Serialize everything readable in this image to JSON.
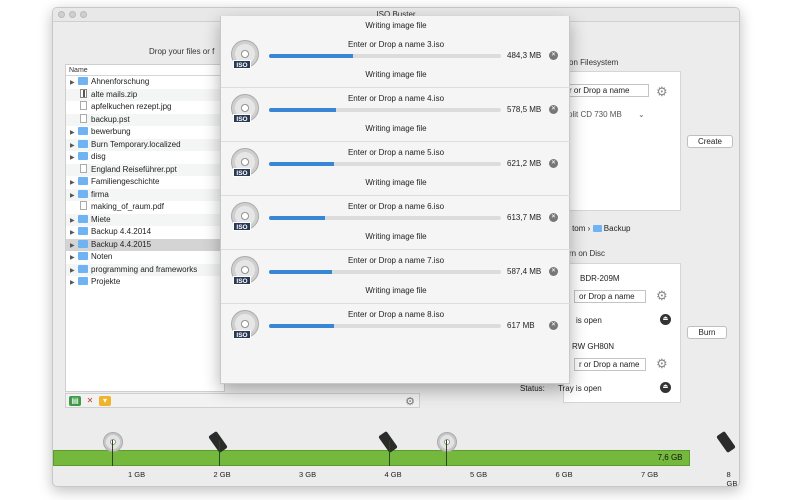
{
  "window": {
    "title": "ISO Buster"
  },
  "left": {
    "drop_hint": "Drop your files or f",
    "column_header": "Name",
    "files": [
      {
        "name": "Ahnenforschung",
        "kind": "folder",
        "expandable": true
      },
      {
        "name": "alte mails.zip",
        "kind": "zip",
        "expandable": false
      },
      {
        "name": "apfelkuchen rezept.jpg",
        "kind": "doc",
        "expandable": false
      },
      {
        "name": "backup.pst",
        "kind": "doc",
        "expandable": false
      },
      {
        "name": "bewerbung",
        "kind": "folder",
        "expandable": true
      },
      {
        "name": "Burn Temporary.localized",
        "kind": "folder",
        "expandable": true
      },
      {
        "name": "disg",
        "kind": "folder",
        "expandable": true
      },
      {
        "name": "England Reiseführer.ppt",
        "kind": "doc",
        "expandable": false
      },
      {
        "name": "Familiengeschichte",
        "kind": "folder",
        "expandable": true
      },
      {
        "name": "firma",
        "kind": "folder",
        "expandable": true
      },
      {
        "name": "making_of_raum.pdf",
        "kind": "doc",
        "expandable": false
      },
      {
        "name": "Miete",
        "kind": "folder",
        "expandable": true
      },
      {
        "name": "Backup 4.4.2014",
        "kind": "folder",
        "expandable": true
      },
      {
        "name": "Backup 4.4.2015",
        "kind": "folder",
        "expandable": true,
        "selected": true
      },
      {
        "name": "Noten",
        "kind": "folder",
        "expandable": true
      },
      {
        "name": "programming and frameworks",
        "kind": "folder",
        "expandable": true
      },
      {
        "name": "Projekte",
        "kind": "folder",
        "expandable": true
      }
    ]
  },
  "right": {
    "filesystem_title": "on Filesystem",
    "filesystem_name_placeholder": "r or Drop a name",
    "filesystem_split": "plit CD 730 MB",
    "create_label": "Create",
    "breadcrumb_user": "tom",
    "breadcrumb_folder": "Backup",
    "burn_title": "rn on Disc",
    "drive1_name": "BDR-209M",
    "drive1_field": "or Drop a name",
    "drive1_status_value": "is open",
    "burn_label": "Burn",
    "drive2_name": "RW GH80N",
    "drive2_field": "r or Drop a name",
    "drive2_status_label": "Status:",
    "drive2_status_value": "Tray is open"
  },
  "popup": {
    "top_status": "Writing image file",
    "jobs": [
      {
        "name": "Enter or Drop a name 3.iso",
        "size": "484,3 MB",
        "status": "Writing image file",
        "progress": 0.36
      },
      {
        "name": "Enter or Drop a name 4.iso",
        "size": "578,5 MB",
        "status": "Writing image file",
        "progress": 0.29
      },
      {
        "name": "Enter or Drop a name 5.iso",
        "size": "621,2 MB",
        "status": "Writing image file",
        "progress": 0.28
      },
      {
        "name": "Enter or Drop a name 6.iso",
        "size": "613,7 MB",
        "status": "Writing image file",
        "progress": 0.24
      },
      {
        "name": "Enter or Drop a name 7.iso",
        "size": "587,4 MB",
        "status": "Writing image file",
        "progress": 0.27
      },
      {
        "name": "Enter or Drop a name 8.iso",
        "size": "617 MB",
        "status": "",
        "progress": 0.28
      }
    ],
    "iso_tag": "ISO"
  },
  "capacity": {
    "total_label": "7,6 GB",
    "ticks": [
      "1 GB",
      "2 GB",
      "3 GB",
      "4 GB",
      "5 GB",
      "6 GB",
      "7 GB",
      "8 GB"
    ],
    "fill_fraction": 0.95
  },
  "colors": {
    "accent": "#3a86d6",
    "capacity": "#75b83e",
    "folder": "#6fb3f2"
  }
}
